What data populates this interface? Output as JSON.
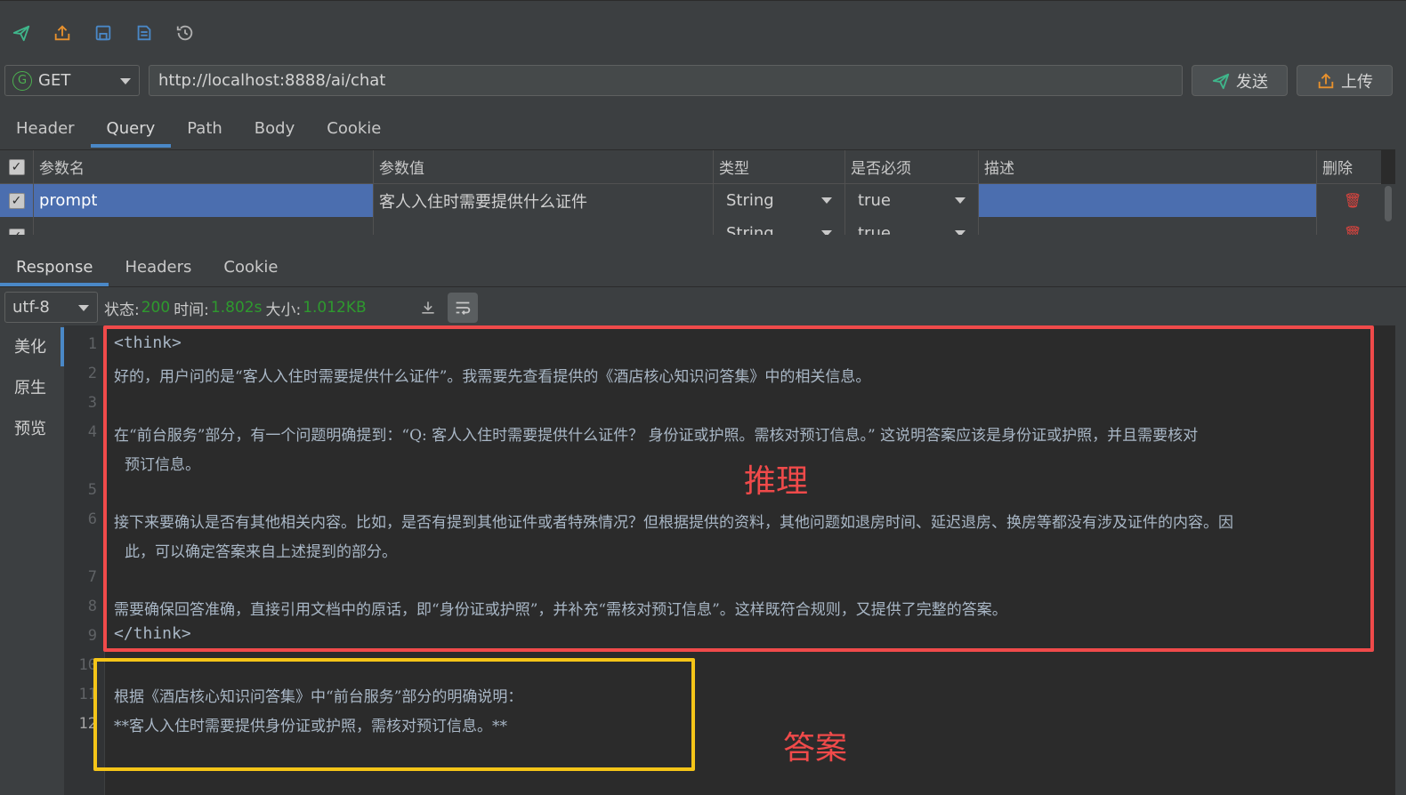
{
  "toolbar": {
    "icons": [
      "send-icon",
      "upload-icon",
      "save-icon",
      "document-icon",
      "history-icon"
    ]
  },
  "request": {
    "method_badge": "G",
    "method": "GET",
    "url": "http://localhost:8888/ai/chat",
    "send_label": "发送",
    "upload_label": "上传"
  },
  "request_tabs": [
    "Header",
    "Query",
    "Path",
    "Body",
    "Cookie"
  ],
  "request_tabs_active": "Query",
  "params": {
    "headers": [
      "参数名",
      "参数值",
      "类型",
      "是否必须",
      "描述",
      "删除"
    ],
    "rows": [
      {
        "name": "prompt",
        "value": "客人入住时需要提供什么证件",
        "type": "String",
        "required": "true",
        "desc": ""
      },
      {
        "name": "",
        "value": "",
        "type": "String",
        "required": "true",
        "desc": ""
      }
    ]
  },
  "response_tabs": [
    "Response",
    "Headers",
    "Cookie"
  ],
  "response_tabs_active": "Response",
  "status_bar": {
    "encoding": "utf-8",
    "status_label": "状态:",
    "status_value": "200",
    "time_label": "时间:",
    "time_value": "1.802s",
    "size_label": "大小:",
    "size_value": "1.012KB"
  },
  "view_tabs": [
    "美化",
    "原生",
    "预览"
  ],
  "view_tabs_active": "美化",
  "editor": {
    "line_numbers": [
      "1",
      "2",
      "3",
      "4",
      "5",
      "6",
      "7",
      "8",
      "9",
      "10",
      "11",
      "12"
    ],
    "lines": {
      "l1": "<think>",
      "l2": "好的，用户问的是“客人入住时需要提供什么证件”。我需要先查看提供的《酒店核心知识问答集》中的相关信息。",
      "l4a": "在“前台服务”部分，有一个问题明确提到：“Q: 客人入住时需要提供什么证件？  身份证或护照。需核对预订信息。” 这说明答案应该是身份证或护照，并且需要核对",
      "l4b": "预订信息。",
      "l6a": "接下来要确认是否有其他相关内容。比如，是否有提到其他证件或者特殊情况？但根据提供的资料，其他问题如退房时间、延迟退房、换房等都没有涉及证件的内容。因",
      "l6b": "此，可以确定答案来自上述提到的部分。",
      "l8": "需要确保回答准确，直接引用文档中的原话，即“身份证或护照”，并补充“需核对预订信息”。这样既符合规则，又提供了完整的答案。",
      "l9": "</think>",
      "l11": "根据《酒店核心知识问答集》中“前台服务”部分的明确说明：",
      "l12": "**客人入住时需要提供身份证或护照，需核对预订信息。**"
    }
  },
  "annotations": {
    "reasoning_label": "推理",
    "answer_label": "答案",
    "reasoning_color": "#f04a4a",
    "answer_color": "#f5c518"
  }
}
